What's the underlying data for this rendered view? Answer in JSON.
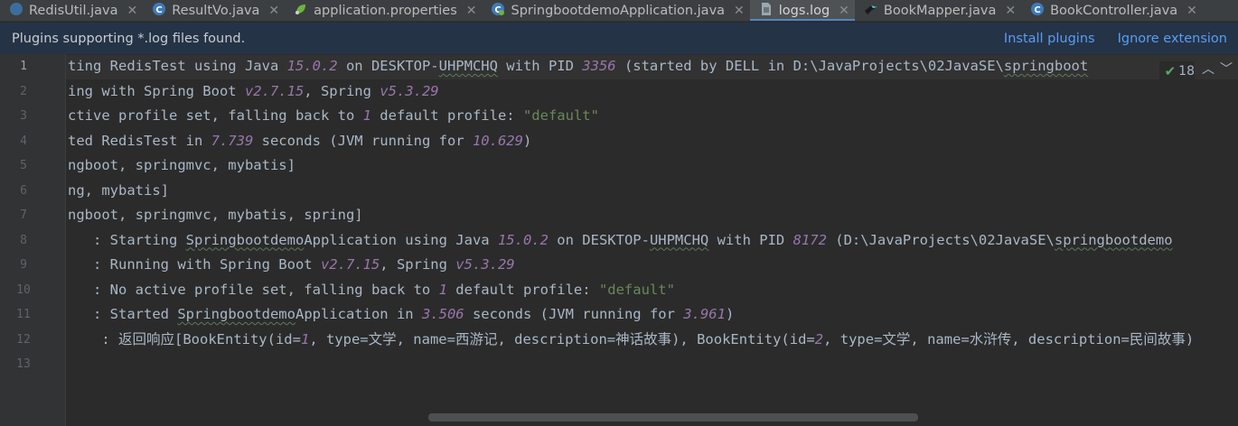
{
  "tabs": [
    {
      "label": "RedisUtil.java",
      "icon": "java-class-icon",
      "active": false
    },
    {
      "label": "ResultVo.java",
      "icon": "class-icon",
      "active": false
    },
    {
      "label": "application.properties",
      "icon": "spring-properties-icon",
      "active": false
    },
    {
      "label": "SpringbootdemoApplication.java",
      "icon": "spring-class-icon",
      "active": false
    },
    {
      "label": "logs.log",
      "icon": "log-file-icon",
      "active": true
    },
    {
      "label": "BookMapper.java",
      "icon": "mybatis-bird-icon",
      "active": false
    },
    {
      "label": "BookController.java",
      "icon": "class-icon",
      "active": false
    }
  ],
  "banner": {
    "text": "Plugins supporting *.log files found.",
    "install": "Install plugins",
    "ignore": "Ignore extension"
  },
  "inspection": {
    "count": "18"
  },
  "lines": [
    [
      "1",
      [
        [
          "t",
          "ting RedisTest using Java "
        ],
        [
          "n",
          "15.0.2"
        ],
        [
          "t",
          " on DESKTOP-"
        ],
        [
          "w",
          "UHPMCHQ"
        ],
        [
          "t",
          " with PID "
        ],
        [
          "n",
          "3356"
        ],
        [
          "t",
          " (started by DELL in D:\\JavaProjects\\02JavaSE\\"
        ],
        [
          "w",
          "springboot"
        ]
      ]
    ],
    [
      "2",
      [
        [
          "t",
          "ing with Spring Boot "
        ],
        [
          "n",
          "v2.7.15"
        ],
        [
          "t",
          ", Spring "
        ],
        [
          "n",
          "v5.3.29"
        ]
      ]
    ],
    [
      "3",
      [
        [
          "t",
          "ctive profile set, falling back to "
        ],
        [
          "n",
          "1"
        ],
        [
          "t",
          " default profile: "
        ],
        [
          "s",
          "\"default\""
        ]
      ]
    ],
    [
      "4",
      [
        [
          "t",
          "ted RedisTest in "
        ],
        [
          "n",
          "7.739"
        ],
        [
          "t",
          " seconds (JVM running for "
        ],
        [
          "n",
          "10.629"
        ],
        [
          "t",
          ")"
        ]
      ]
    ],
    [
      "5",
      [
        [
          "t",
          "ngboot, springmvc, mybatis]"
        ]
      ]
    ],
    [
      "6",
      [
        [
          "t",
          "ng, mybatis]"
        ]
      ]
    ],
    [
      "7",
      [
        [
          "t",
          "ngboot, springmvc, mybatis, spring]"
        ]
      ]
    ],
    [
      "8",
      [
        [
          "t",
          "   : Starting "
        ],
        [
          "w",
          "Springbootdemo"
        ],
        [
          "t",
          "Application using Java "
        ],
        [
          "n",
          "15.0.2"
        ],
        [
          "t",
          " on DESKTOP-"
        ],
        [
          "w",
          "UHPMCHQ"
        ],
        [
          "t",
          " with PID "
        ],
        [
          "n",
          "8172"
        ],
        [
          "t",
          " (D:\\JavaProjects\\02JavaSE\\"
        ],
        [
          "w",
          "springbootdemo"
        ]
      ]
    ],
    [
      "9",
      [
        [
          "t",
          "   : Running with Spring Boot "
        ],
        [
          "n",
          "v2.7.15"
        ],
        [
          "t",
          ", Spring "
        ],
        [
          "n",
          "v5.3.29"
        ]
      ]
    ],
    [
      "10",
      [
        [
          "t",
          "   : No active profile set, falling back to "
        ],
        [
          "n",
          "1"
        ],
        [
          "t",
          " default profile: "
        ],
        [
          "s",
          "\"default\""
        ]
      ]
    ],
    [
      "11",
      [
        [
          "t",
          "   : Started "
        ],
        [
          "w",
          "Springbootdemo"
        ],
        [
          "t",
          "Application in "
        ],
        [
          "n",
          "3.506"
        ],
        [
          "t",
          " seconds (JVM running for "
        ],
        [
          "n",
          "3.961"
        ],
        [
          "t",
          ")"
        ]
      ]
    ],
    [
      "12",
      [
        [
          "t",
          "    : 返回响应[BookEntity(id="
        ],
        [
          "n",
          "1"
        ],
        [
          "t",
          ", type=文学, name=西游记, description=神话故事), BookEntity(id="
        ],
        [
          "n",
          "2"
        ],
        [
          "t",
          ", type=文学, name=水浒传, description=民间故事)"
        ]
      ]
    ],
    [
      "13",
      []
    ]
  ],
  "colors": {
    "accent": "#4a88c7",
    "link": "#589df6",
    "number": "#9876aa",
    "string": "#6a8759",
    "text": "#a9b7c6"
  }
}
